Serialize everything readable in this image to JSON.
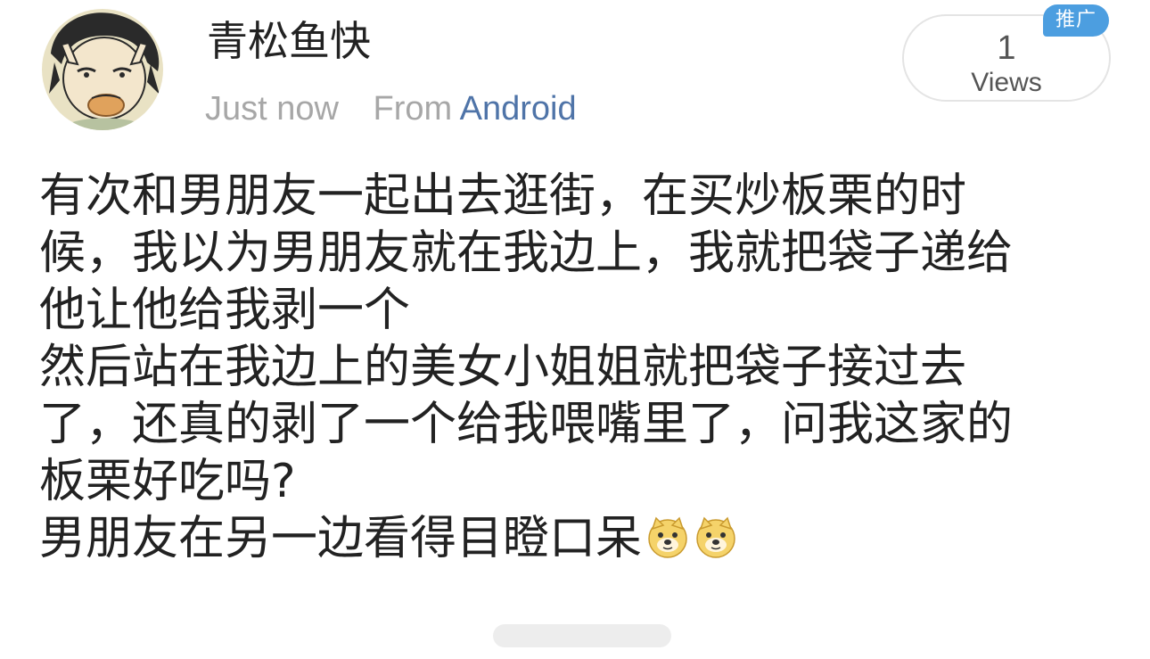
{
  "user": {
    "name": "青松鱼快",
    "avatar_icon": "cartoon-avatar-icon"
  },
  "meta": {
    "time": "Just now",
    "source_prefix": "From",
    "source_name": "Android"
  },
  "views": {
    "count": "1",
    "label": "Views"
  },
  "badge": {
    "label": "推广",
    "color": "#4c9ee0"
  },
  "post": {
    "lines": [
      "有次和男朋友一起出去逛街，在买炒板栗的时",
      "候，我以为男朋友就在我边上，我就把袋子递给",
      "他让他给我剥一个",
      "然后站在我边上的美女小姐姐就把袋子接过去",
      "了，还真的剥了一个给我喂嘴里了，问我这家的",
      "板栗好吃吗?",
      "男朋友在另一边看得目瞪口呆"
    ],
    "emojis": [
      "doge-emoji-icon",
      "doge-emoji-icon"
    ]
  },
  "colors": {
    "text": "#222222",
    "meta": "#a7a7a7",
    "link": "#4f74a8"
  }
}
